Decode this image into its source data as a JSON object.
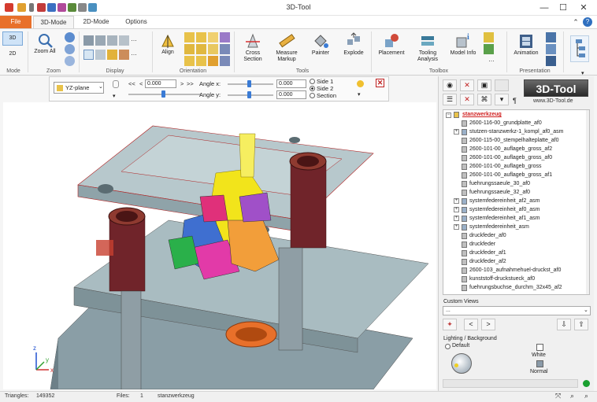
{
  "app": {
    "title": "3D-Tool"
  },
  "window": {
    "minimize": "—",
    "maximize": "☐",
    "close": "✕"
  },
  "tabs": [
    {
      "label": "File"
    },
    {
      "label": "3D-Mode"
    },
    {
      "label": "2D-Mode"
    },
    {
      "label": "Options"
    }
  ],
  "ribbon": {
    "mode": {
      "group": "Mode",
      "btn3d": "3D",
      "btn2d": "2D"
    },
    "zoom": {
      "group": "Zoom",
      "zoom_all": "Zoom All"
    },
    "display": {
      "group": "Display"
    },
    "orientation": {
      "group": "Orientation",
      "align": "Align"
    },
    "tools": {
      "group": "Tools",
      "section": "Cross Section",
      "measure": "Measure Markup",
      "painter": "Painter",
      "explode": "Explode"
    },
    "toolbox": {
      "group": "Toolbox",
      "placement": "Placement",
      "tooling": "Tooling Analysis",
      "model_info": "Model Info"
    },
    "presentation": {
      "group": "Presentation",
      "animation": "Animation"
    }
  },
  "orient_bar": {
    "plane": "YZ-plane",
    "nav_prev": "<<",
    "nav_back": "<",
    "nav_fwd": ">",
    "nav_next": ">>",
    "value": "0.000",
    "angle_x_label": "Angle x:",
    "angle_x_value": "0.000",
    "angle_y_label": "Angle y:",
    "angle_y_value": "0.000",
    "side1": "Side 1",
    "side2": "Side 2",
    "section": "Section",
    "selected_side": "Side 2"
  },
  "panel": {
    "logo": "3D-Tool",
    "url": "www.3D-Tool.de",
    "custom_views_label": "Custom Views",
    "custom_views_value": "...",
    "lighting_label": "Lighting / Background",
    "default_label": "Default",
    "white_label": "White",
    "normal_label": "Normal"
  },
  "tree": {
    "root": "stanzwerkzeug",
    "items": [
      {
        "label": "2600-116-00_grundplatte_af0",
        "exp": ""
      },
      {
        "label": "stutzen-stanzwerkz-1_kompl_af0_asm",
        "exp": "+"
      },
      {
        "label": "2600-115-00_stempelhalteplatte_af0",
        "exp": ""
      },
      {
        "label": "2600-101-00_auflageb_gross_af2",
        "exp": ""
      },
      {
        "label": "2600-101-00_auflageb_gross_af0",
        "exp": ""
      },
      {
        "label": "2600-101-00_auflageb_gross",
        "exp": ""
      },
      {
        "label": "2600-101-00_auflageb_gross_af1",
        "exp": ""
      },
      {
        "label": "fuehrungssaeule_30_af0",
        "exp": ""
      },
      {
        "label": "fuehrungssaeule_32_af0",
        "exp": ""
      },
      {
        "label": "systemfedereinheit_af2_asm",
        "exp": "+"
      },
      {
        "label": "systemfedereinheit_af0_asm",
        "exp": "+"
      },
      {
        "label": "systemfedereinheit_af1_asm",
        "exp": "+"
      },
      {
        "label": "systemfedereinheit_asm",
        "exp": "+"
      },
      {
        "label": "druckfeder_af0",
        "exp": ""
      },
      {
        "label": "druckfeder",
        "exp": ""
      },
      {
        "label": "druckfeder_af1",
        "exp": ""
      },
      {
        "label": "druckfeder_af2",
        "exp": ""
      },
      {
        "label": "2600-103_aufnahmehuel-druckst_af0",
        "exp": ""
      },
      {
        "label": "kunststoff-druckstueck_af0",
        "exp": ""
      },
      {
        "label": "fuehrungsbuchse_durchm_32x45_af2",
        "exp": ""
      }
    ]
  },
  "status": {
    "triangles_label": "Triangles:",
    "triangles_value": "149352",
    "files_label": "Files:",
    "files_value": "1",
    "filename": "stanzwerkzeug"
  },
  "viewport_axes": {
    "x": "x",
    "y": "y",
    "z": "z"
  },
  "colors": {
    "accent": "#e8702a",
    "file_tab": "#e8702a",
    "part_gray": "#9eb0b4",
    "part_brown": "#7a2a20",
    "part_yellow": "#f2e41b",
    "part_orange": "#e8702a"
  }
}
